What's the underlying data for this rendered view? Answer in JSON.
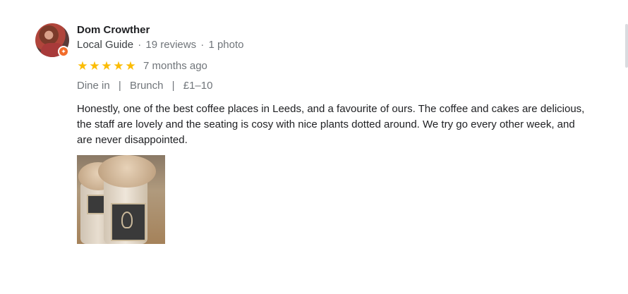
{
  "review": {
    "author": "Dom Crowther",
    "guide_label": "Local Guide",
    "reviews_count": "19 reviews",
    "photos_count": "1 photo",
    "meta_separator": "·",
    "rating": 5,
    "stars": [
      "★",
      "★",
      "★",
      "★",
      "★"
    ],
    "time_ago": "7 months ago",
    "tags": [
      "Dine in",
      "Brunch",
      "£1–10"
    ],
    "tag_separator": "|",
    "text": "Honestly, one of the best coffee places in Leeds, and a favourite of ours. The coffee and cakes are delicious, the staff are lovely and the seating is cosy with nice plants dotted around. We try go every other week, and are never disappointed.",
    "badge_glyph": "✦"
  },
  "colors": {
    "star": "#fbbc04",
    "badge": "#f26c2a",
    "meta_text": "#70757a",
    "body_text": "#202124"
  }
}
